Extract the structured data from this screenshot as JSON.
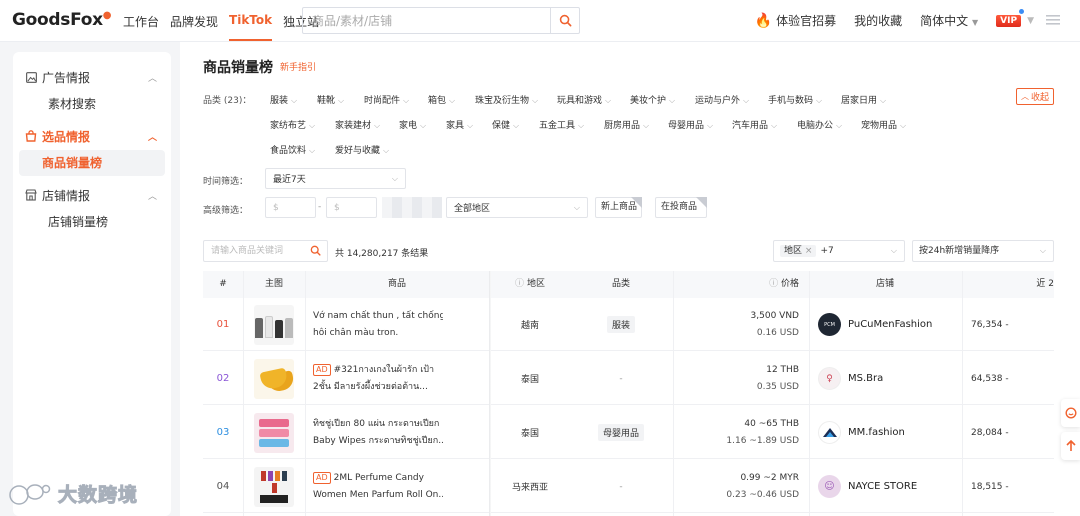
{
  "brand": {
    "name": "GoodsFox"
  },
  "nav": {
    "items": [
      "工作台",
      "品牌发现",
      "TikTok",
      "独立站"
    ],
    "active_index": 2
  },
  "search": {
    "placeholder": "商品/素材/店铺"
  },
  "topbar_right": {
    "recruit": "体验官招募",
    "favorites": "我的收藏",
    "language": "简体中文",
    "vip_badge": "VIP"
  },
  "sidebar": {
    "groups": [
      {
        "label": "广告情报",
        "icon": "image-icon",
        "items": [
          "素材搜索"
        ]
      },
      {
        "label": "选品情报",
        "icon": "shopping-bag-icon",
        "items": [
          "商品销量榜"
        ],
        "active": true
      },
      {
        "label": "店铺情报",
        "icon": "store-icon",
        "items": [
          "店铺销量榜"
        ]
      }
    ],
    "active_item": "商品销量榜"
  },
  "page": {
    "title": "商品销量榜",
    "guide_link": "新手指引"
  },
  "filters": {
    "category_label": "品类 (23)：",
    "categories_row1": [
      "服装",
      "鞋靴",
      "时尚配件",
      "箱包",
      "珠宝及衍生物",
      "玩具和游戏",
      "美妆个护",
      "运动与户外",
      "手机与数码",
      "居家日用"
    ],
    "categories_row2": [
      "家纺布艺",
      "家装建材",
      "家电",
      "家具",
      "保健",
      "五金工具",
      "厨房用品",
      "母婴用品",
      "汽车用品",
      "电脑办公",
      "宠物用品"
    ],
    "categories_row3": [
      "食品饮料",
      "爱好与收藏"
    ],
    "collapse_label": "收起",
    "time_label": "时间筛选：",
    "time_value": "最近7天",
    "advanced_label": "高级筛选：",
    "price_min_placeholder": "$",
    "price_sep": "-",
    "price_max_placeholder": "$",
    "region_value": "全部地区",
    "new_products": "新上商品",
    "ad_products": "在投商品"
  },
  "toolbar": {
    "keyword_placeholder": "请输入商品关键词",
    "total_text": "共 14,280,217 条结果",
    "region_tag": "地区",
    "region_more": "+7",
    "sort_value": "按24h新增销量降序"
  },
  "table": {
    "headers": {
      "rank": "#",
      "image": "主图",
      "product": "商品",
      "region": "地区",
      "category": "品类",
      "price": "价格",
      "store": "店铺",
      "recent": "近 2"
    },
    "rows": [
      {
        "rank": "01",
        "ad": "",
        "name1": "Vớ nam chất thun , tất chống",
        "name2": "hôi chân màu tron.",
        "region": "越南",
        "category": "服装",
        "price_local": "3,500 VND",
        "price_usd": "0.16 USD",
        "store": "PuCuMenFashion",
        "sales": "76,354 -"
      },
      {
        "rank": "02",
        "ad": "AD",
        "name1": "#321กางเกงในผ้ารัก เป้า",
        "name2": "2ชั้น มีลายรังผึ้งช่วยต่อต้าน...",
        "region": "泰国",
        "category": "-",
        "price_local": "12 THB",
        "price_usd": "0.35 USD",
        "store": "MS.Bra",
        "sales": "64,538 -"
      },
      {
        "rank": "03",
        "ad": "",
        "name1": "ทิชชู่เปียก 80 แผ่น กระดาษเปียก",
        "name2": "Baby Wipes กระดาษทิชชู่เปียก...",
        "region": "泰国",
        "category": "母婴用品",
        "price_local": "40 ~65 THB",
        "price_usd": "1.16 ~1.89 USD",
        "store": "MM.fashion",
        "sales": "28,084 -"
      },
      {
        "rank": "04",
        "ad": "AD",
        "name1": "2ML Perfume Candy",
        "name2": "Women Men Parfum Roll On...",
        "region": "马来西亚",
        "category": "-",
        "price_local": "0.99 ~2 MYR",
        "price_usd": "0.23 ~0.46 USD",
        "store": "NAYCE STORE",
        "sales": "18,515 -"
      }
    ]
  },
  "watermark": {
    "text": "大数跨境"
  },
  "colors": {
    "accent": "#f0622f",
    "rank1": "#e8503a",
    "rank2": "#8a56d6",
    "rank3": "#2e8fe0",
    "rank4": "#555555"
  }
}
